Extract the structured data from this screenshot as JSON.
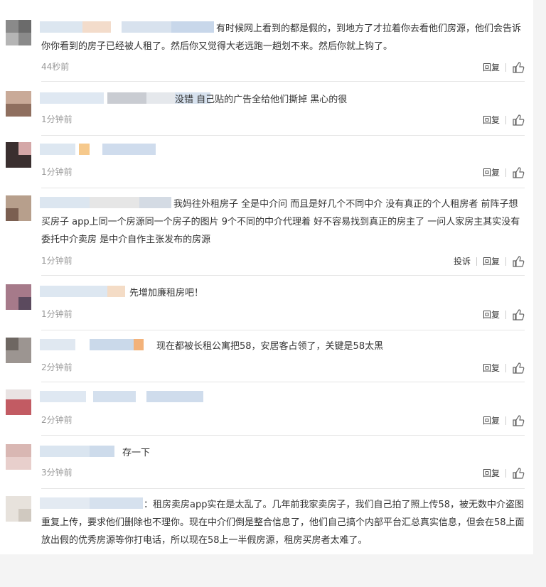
{
  "comments": [
    {
      "text": "有时候网上看到的都是假的，到地方了才拉着你去看他们房源，他们会告诉你你看到的房子已经被人租了。然后你又觉得大老远跑一趟划不来。然后你就上钩了。",
      "time": "44秒前",
      "reply": "回复"
    },
    {
      "text": "没错 自己贴的广告全给他们撕掉 黑心的很",
      "time": "1分钟前",
      "reply": "回复"
    },
    {
      "text": "",
      "time": "1分钟前",
      "reply": "回复"
    },
    {
      "text": "我妈往外租房子 全是中介问 而且是好几个不同中介 没有真正的个人租房者 前阵子想买房子 app上同一个房源同一个房子的图片 9个不同的中介代理着 好不容易找到真正的房主了 一问人家房主其实没有委托中介卖房 是中介自作主张发布的房源",
      "time": "1分钟前",
      "report": "投诉",
      "reply": "回复"
    },
    {
      "text": "先增加廉租房吧！",
      "time": "1分钟前",
      "reply": "回复"
    },
    {
      "text": "现在都被长租公寓把58，安居客占领了，关键是58太黑",
      "time": "2分钟前",
      "reply": "回复"
    },
    {
      "text": "",
      "time": "2分钟前",
      "reply": "回复"
    },
    {
      "text": "存一下",
      "time": "3分钟前",
      "reply": "回复"
    },
    {
      "text": "：租房卖房app实在是太乱了。几年前我家卖房子，我们自己拍了照上传58，被无数中介盗图重复上传，要求他们删除也不理你。现在中介们倒是整合信息了，他们自己搞个内部平台汇总真实信息，但会在58上面放出假的优秀房源等你打电话，所以现在58上一半假房源，租房买房者太难了。",
      "time": "",
      "reply": ""
    }
  ],
  "colors": {
    "text": "#333333",
    "time": "#999999",
    "divider": "#e5e5e5",
    "background": "#f4f4f4"
  },
  "icons": {
    "like": "thumbs-up-icon"
  }
}
